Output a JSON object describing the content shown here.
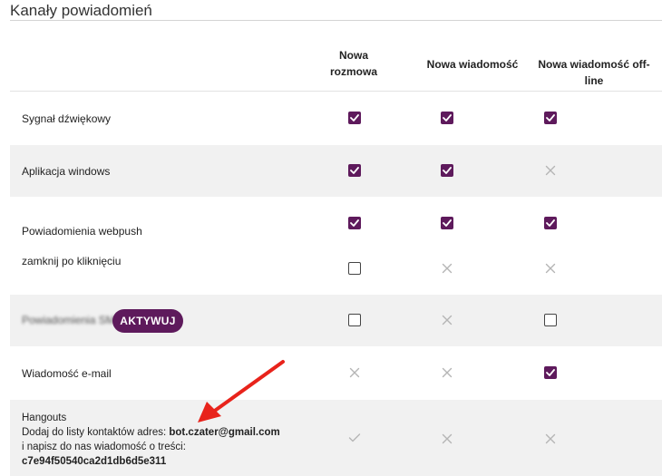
{
  "section": {
    "title": "Kanały powiadomień"
  },
  "columns": [
    "Nowa rozmowa",
    "Nowa wiadomość",
    "Nowa wiadomość off-line"
  ],
  "columns_lines": {
    "c0_l1": "Nowa",
    "c0_l2": "rozmowa"
  },
  "rows": {
    "sound": {
      "label": "Sygnał dźwiękowy",
      "states": [
        "checked",
        "checked",
        "checked"
      ]
    },
    "windows": {
      "label": "Aplikacja windows",
      "states": [
        "checked",
        "checked",
        "unavailable"
      ]
    },
    "webpush": {
      "label": "Powiadomienia webpush",
      "states": [
        "checked",
        "checked",
        "checked"
      ]
    },
    "close_on_click": {
      "label": "zamknij po kliknięciu",
      "states": [
        "unchecked",
        "unavailable",
        "unavailable"
      ]
    },
    "sms": {
      "label": "Powiadomienia SMS",
      "button_label": "AKTYWUJ",
      "states": [
        "unchecked",
        "unavailable",
        "unchecked"
      ]
    },
    "email": {
      "label": "Wiadomość e-mail",
      "states": [
        "unavailable",
        "unavailable",
        "checked"
      ]
    },
    "hangouts": {
      "label": "Hangouts",
      "line1_prefix": "Dodaj do listy kontaktów adres: ",
      "address": "bot.czater@gmail.com",
      "line2": "i napisz do nas wiadomość o treści:",
      "code": "c7e94f50540ca2d1db6d5e311",
      "states": [
        "disabled-check",
        "unavailable",
        "unavailable"
      ]
    }
  },
  "colors": {
    "accent": "#5e1a5c",
    "row_shade": "#f1f1f1",
    "arrow": "#e8231b",
    "x_mark": "#b5b5b5"
  },
  "icons": {
    "checked": "checkbox-checked-icon",
    "unchecked": "checkbox-unchecked-icon",
    "unavailable": "x-icon",
    "disabled-check": "check-mark-icon"
  }
}
